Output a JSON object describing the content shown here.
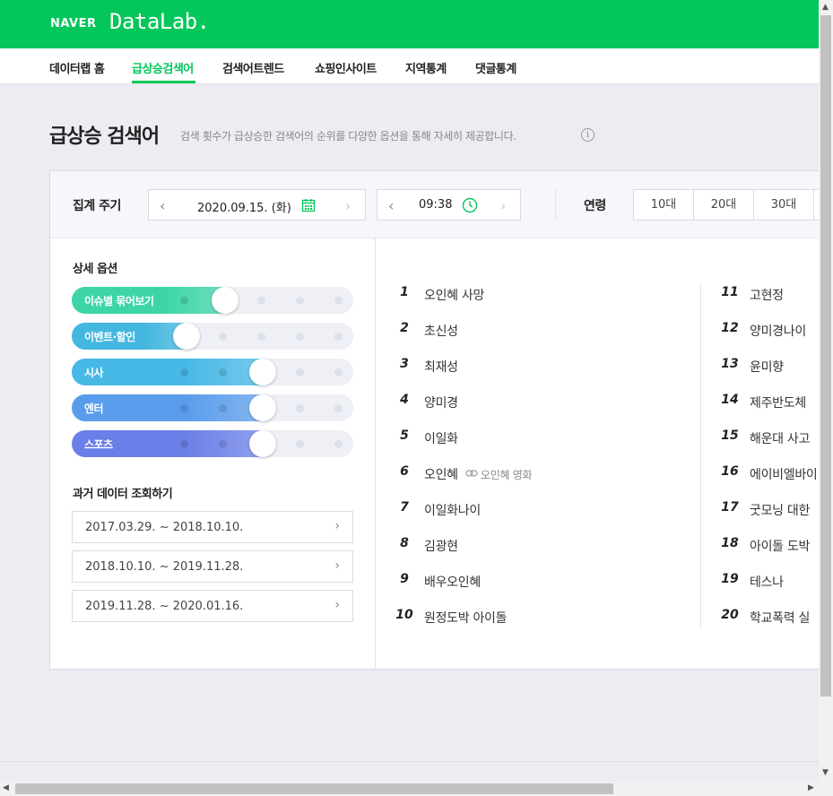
{
  "header": {
    "brand_naver": "NAVER",
    "brand_lab": "DataLab.",
    "brand_color": "#03c75a"
  },
  "menu": [
    {
      "label": "데이터랩 홈",
      "active": false
    },
    {
      "label": "급상승검색어",
      "active": true
    },
    {
      "label": "검색어트렌드",
      "active": false
    },
    {
      "label": "쇼핑인사이트",
      "active": false
    },
    {
      "label": "지역통계",
      "active": false
    },
    {
      "label": "댓글통계",
      "active": false
    }
  ],
  "page": {
    "title": "급상승 검색어",
    "description": "검색 횟수가 급상승한 검색어의 순위를 다양한 옵션을 통해 자세히 제공합니다.",
    "info_icon": "i"
  },
  "filter": {
    "period_label": "집계 주기",
    "date": "2020.09.15. (화)",
    "time": "09:38",
    "age_label": "연령",
    "ages": [
      "10대",
      "20대",
      "30대"
    ],
    "icons": {
      "prev": "‹",
      "next": "›",
      "calendar": "calendar-icon",
      "clock": "clock-icon"
    }
  },
  "options": {
    "title": "상세 옵션",
    "sliders": [
      {
        "label": "이슈별 묶어보기",
        "color": "#3dd5a8",
        "level": 1
      },
      {
        "label": "이벤트·할인",
        "color": "#43b7e0",
        "level": 0
      },
      {
        "label": "시사",
        "color": "#47b9e6",
        "level": 2
      },
      {
        "label": "엔터",
        "color": "#5a9cec",
        "level": 2
      },
      {
        "label": "스포츠",
        "color": "#6b7fe8",
        "level": 2
      }
    ]
  },
  "history": {
    "title": "과거 데이터 조회하기",
    "items": [
      "2017.03.29. ~ 2018.10.10.",
      "2018.10.10. ~ 2019.11.28.",
      "2019.11.28. ~ 2020.01.16."
    ],
    "chevron": "›"
  },
  "ranks_left": [
    {
      "rank": "1",
      "keyword": "오인혜 사망",
      "related": ""
    },
    {
      "rank": "2",
      "keyword": "초신성",
      "related": ""
    },
    {
      "rank": "3",
      "keyword": "최재성",
      "related": ""
    },
    {
      "rank": "4",
      "keyword": "양미경",
      "related": ""
    },
    {
      "rank": "5",
      "keyword": "이일화",
      "related": ""
    },
    {
      "rank": "6",
      "keyword": "오인혜",
      "related": "오인혜 영화"
    },
    {
      "rank": "7",
      "keyword": "이일화나이",
      "related": ""
    },
    {
      "rank": "8",
      "keyword": "김광현",
      "related": ""
    },
    {
      "rank": "9",
      "keyword": "배우오인혜",
      "related": ""
    },
    {
      "rank": "10",
      "keyword": "원정도박 아이돌",
      "related": ""
    }
  ],
  "ranks_right": [
    {
      "rank": "11",
      "keyword": "고현정"
    },
    {
      "rank": "12",
      "keyword": "양미경나이"
    },
    {
      "rank": "13",
      "keyword": "윤미향"
    },
    {
      "rank": "14",
      "keyword": "제주반도체"
    },
    {
      "rank": "15",
      "keyword": "해운대 사고"
    },
    {
      "rank": "16",
      "keyword": "에이비엘바이"
    },
    {
      "rank": "17",
      "keyword": "굿모닝 대한"
    },
    {
      "rank": "18",
      "keyword": "아이돌 도박"
    },
    {
      "rank": "19",
      "keyword": "테스나"
    },
    {
      "rank": "20",
      "keyword": "학교폭력 실"
    }
  ],
  "scroll": {
    "up": "▲",
    "down": "▼",
    "left": "◀",
    "right": "▶"
  }
}
